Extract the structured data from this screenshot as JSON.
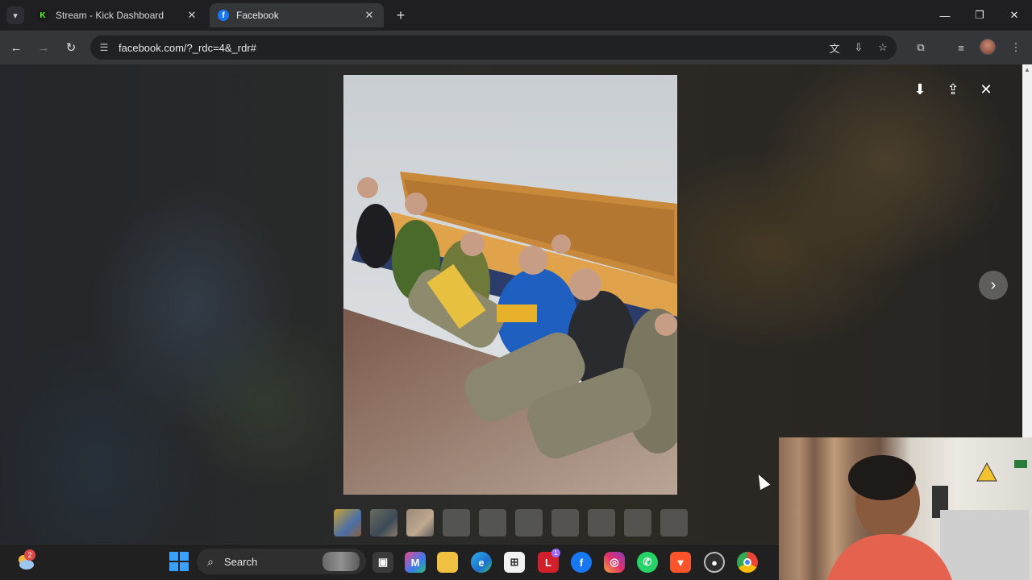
{
  "browser": {
    "tabs": [
      {
        "title": "Stream - Kick Dashboard",
        "icon": "kick-icon",
        "active": false
      },
      {
        "title": "Facebook",
        "icon": "facebook-icon",
        "active": true
      }
    ],
    "url": "facebook.com/?_rdc=4&_rdr#"
  },
  "viewer": {
    "thumbnail_count": 10,
    "next_label": "Next photo"
  },
  "taskbar": {
    "weather_badge": "2",
    "search_placeholder": "Search",
    "store_badge": "1",
    "app_icons": [
      "task-view-icon",
      "m365-copilot-icon",
      "file-explorer-icon",
      "edge-icon",
      "microsoft-store-icon",
      "lastpass-icon",
      "facebook-icon",
      "instagram-icon",
      "whatsapp-icon",
      "brave-icon",
      "recording-icon",
      "chrome-icon"
    ]
  },
  "colors": {
    "tab_bg": "#1f1f23",
    "toolbar_bg": "#35363a",
    "omnibox_bg": "#202124",
    "taskbar_bg": "#202020",
    "facebook_blue": "#1877f2",
    "kick_green": "#53fc18"
  }
}
